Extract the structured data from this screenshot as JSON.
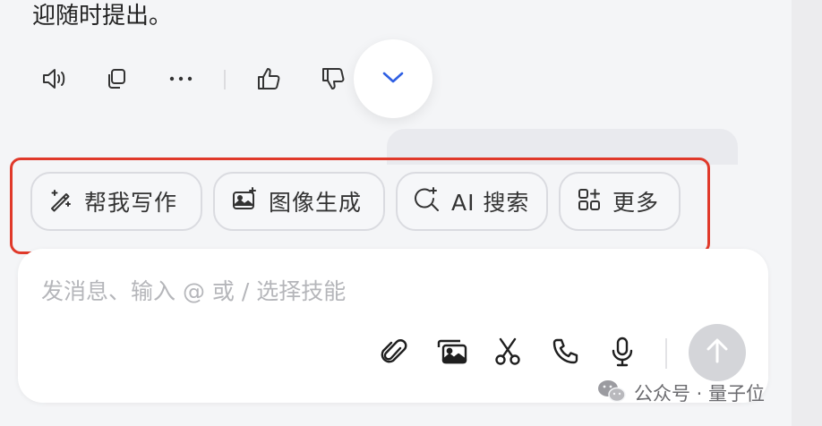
{
  "message": {
    "tail_text": "迎随时提出。"
  },
  "message_actions": {
    "items": [
      {
        "name": "read-aloud",
        "icon": "speaker-icon"
      },
      {
        "name": "copy",
        "icon": "copy-icon"
      },
      {
        "name": "more",
        "icon": "more-dots-icon"
      },
      {
        "name": "like",
        "icon": "thumbs-up-icon"
      },
      {
        "name": "dislike",
        "icon": "thumbs-down-icon"
      }
    ]
  },
  "scroll_button": {
    "icon": "chevron-down-icon",
    "color": "#2f5fe3"
  },
  "skills": [
    {
      "label": "帮我写作",
      "icon": "magic-pen-icon"
    },
    {
      "label": "图像生成",
      "icon": "image-generate-icon"
    },
    {
      "label": "AI 搜索",
      "icon": "ai-search-icon"
    },
    {
      "label": "更多",
      "icon": "grid-plus-icon"
    }
  ],
  "composer": {
    "placeholder": "发消息、输入 @ 或 / 选择技能",
    "tools": [
      {
        "name": "attach",
        "icon": "paperclip-icon"
      },
      {
        "name": "images",
        "icon": "image-stack-icon"
      },
      {
        "name": "screenshot",
        "icon": "scissors-icon"
      },
      {
        "name": "call",
        "icon": "phone-icon"
      },
      {
        "name": "voice",
        "icon": "microphone-icon"
      }
    ],
    "send_icon": "arrow-up-icon"
  },
  "watermark": {
    "text": "公众号 · 量子位",
    "icon": "wechat-icon"
  },
  "colors": {
    "highlight": "#e0392a",
    "accent": "#2f5fe3",
    "send_disabled": "#d4d5d9"
  }
}
